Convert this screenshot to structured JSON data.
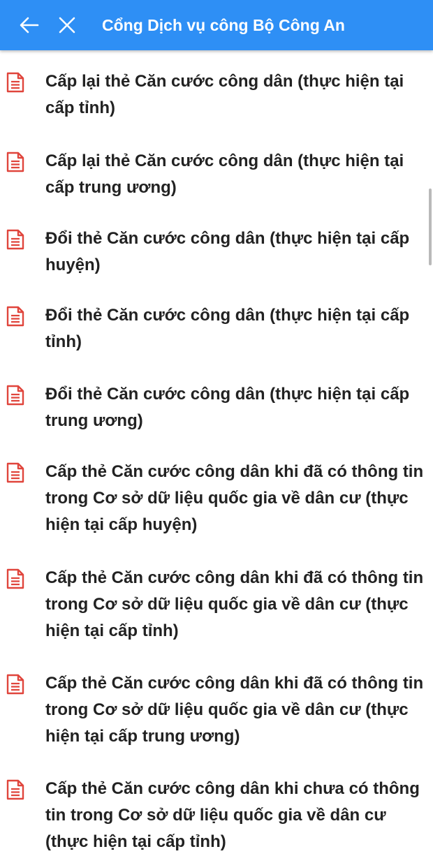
{
  "header": {
    "title": "Cổng Dịch vụ công Bộ Công An",
    "back_icon": "arrow-left-icon",
    "close_icon": "close-icon"
  },
  "colors": {
    "appbar": "#2e8ff5",
    "icon_red": "#e0453c",
    "text": "#222222"
  },
  "services": [
    {
      "label": "Cấp lại thẻ Căn cước công dân (thực hiện tại cấp tỉnh)",
      "icon": "document-icon"
    },
    {
      "label": "Cấp lại thẻ Căn cước công dân (thực hiện tại cấp trung ương)",
      "icon": "document-icon"
    },
    {
      "label": "Đổi thẻ Căn cước công dân (thực hiện tại cấp huyện)",
      "icon": "document-icon"
    },
    {
      "label": "Đổi thẻ Căn cước công dân (thực hiện tại cấp tỉnh)",
      "icon": "document-icon"
    },
    {
      "label": "Đổi thẻ Căn cước công dân (thực hiện tại cấp trung ương)",
      "icon": "document-icon"
    },
    {
      "label": "Cấp thẻ Căn cước công dân khi đã có thông tin trong Cơ sở dữ liệu quốc gia về dân cư (thực hiện tại cấp huyện)",
      "icon": "document-icon"
    },
    {
      "label": "Cấp thẻ Căn cước công dân khi đã có thông tin trong Cơ sở dữ liệu quốc gia về dân cư (thực hiện tại cấp tỉnh)",
      "icon": "document-icon"
    },
    {
      "label": "Cấp thẻ Căn cước công dân khi đã có thông tin trong Cơ sở dữ liệu quốc gia về dân cư (thực hiện tại cấp trung ương)",
      "icon": "document-icon"
    },
    {
      "label": "Cấp thẻ Căn cước công dân khi chưa có thông tin trong Cơ sở dữ liệu quốc gia về dân cư (thực hiện tại cấp tỉnh)",
      "icon": "document-icon"
    }
  ]
}
